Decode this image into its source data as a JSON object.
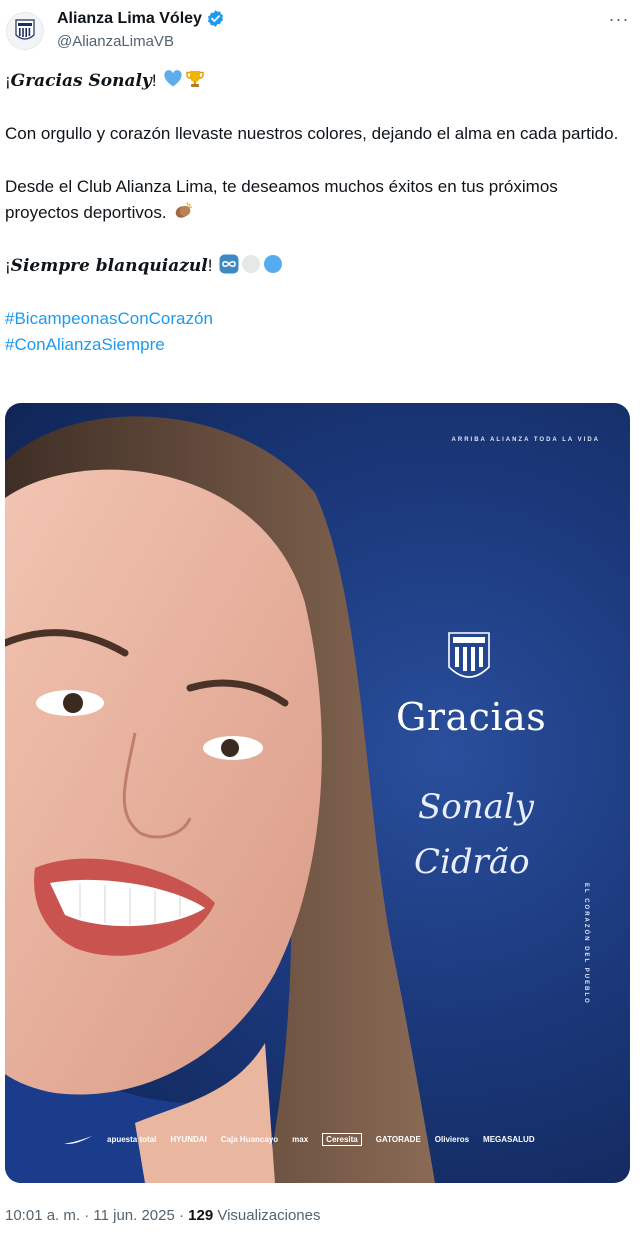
{
  "account": {
    "display_name": "Alianza Lima Vóley",
    "handle": "@AlianzaLimaVB",
    "verified": true,
    "verified_color": "#1d9bf0"
  },
  "tweet": {
    "line1_prefix": "¡",
    "line1_bold": "Gracias Sonaly",
    "line1_suffix": "!",
    "line1_emojis": [
      "blue-heart-icon",
      "trophy-icon"
    ],
    "paragraph2": "Con orgullo y corazón llevaste nuestros colores, dejando el alma en cada partido.",
    "paragraph3": "Desde el Club Alianza Lima, te deseamos muchos éxitos en tus próximos proyectos deportivos.",
    "paragraph3_emoji": "clapping-hands-icon",
    "line4_prefix": "¡",
    "line4_bold": "Siempre blanquiazul",
    "line4_suffix": "!",
    "line4_emojis": [
      "infinity-icon",
      "white-circle-icon",
      "blue-circle-icon"
    ],
    "hashtags": [
      "#BicampeonasConCorazón",
      "#ConAlianzaSiempre"
    ]
  },
  "media": {
    "slogan_top": "ARRIBA ALIANZA TODA LA VIDA",
    "title": "Gracias",
    "signature_line1": "Sonaly",
    "signature_line2": "Cidrão",
    "vertical_slogan": "EL CORAZÓN DEL PUEBLO",
    "sponsors": [
      "apuesta total",
      "HYUNDAI",
      "Caja Huancayo",
      "max",
      "Ceresita",
      "GATORADE",
      "Olivieros",
      "MEGASALUD"
    ]
  },
  "meta": {
    "time": "10:01 a. m. · 11 jun. 2025 · ",
    "views_count": "129",
    "views_label": " Visualizaciones"
  }
}
